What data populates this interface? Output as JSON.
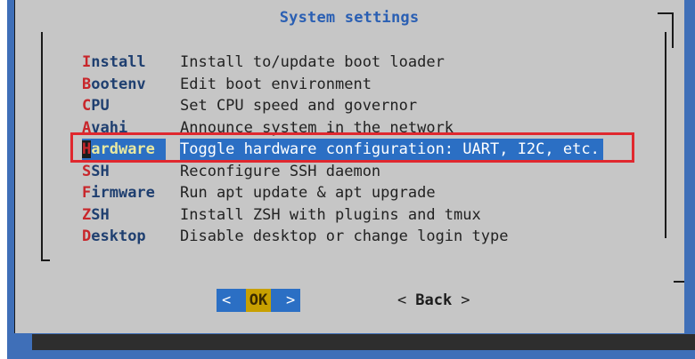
{
  "dialog": {
    "title": "System settings",
    "selected_index": 4
  },
  "menu": {
    "items": [
      {
        "hotkey": "I",
        "rest": "nstall",
        "description": "Install to/update boot loader"
      },
      {
        "hotkey": "B",
        "rest": "ootenv",
        "description": "Edit boot environment"
      },
      {
        "hotkey": "C",
        "rest": "PU",
        "description": "Set CPU speed and governor"
      },
      {
        "hotkey": "A",
        "rest": "vahi",
        "description": "Announce system in the network"
      },
      {
        "hotkey": "H",
        "rest": "ardware",
        "description": "Toggle hardware configuration: UART, I2C, etc."
      },
      {
        "hotkey": "S",
        "rest": "SH",
        "description": "Reconfigure SSH daemon"
      },
      {
        "hotkey": "F",
        "rest": "irmware",
        "description": "Run apt update & apt upgrade"
      },
      {
        "hotkey": "Z",
        "rest": "SH",
        "description": "Install ZSH with plugins and tmux"
      },
      {
        "hotkey": "D",
        "rest": "esktop",
        "description": "Disable desktop or change login type"
      }
    ]
  },
  "buttons": {
    "ok": {
      "left": "<",
      "label": "OK",
      "right": ">"
    },
    "back": {
      "left": "<",
      "label": "Back",
      "right": ">"
    }
  },
  "colors": {
    "background": "#3f6fb8",
    "dialog": "#c6c6c6",
    "title": "#2a5fb3",
    "hotkey": "#c8262b",
    "selection": "#2b6fc4",
    "highlight_box": "#e0282e"
  }
}
